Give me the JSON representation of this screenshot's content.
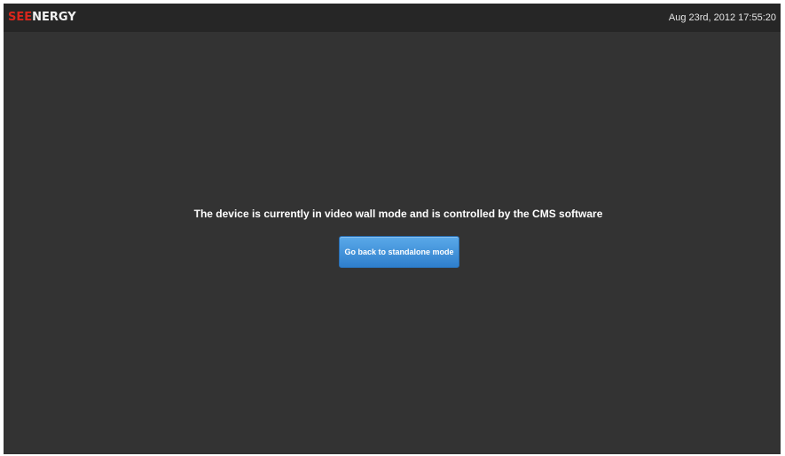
{
  "header": {
    "logo_part1": "SEE",
    "logo_part2": "NERGY",
    "datetime": "Aug 23rd, 2012 17:55:20"
  },
  "main": {
    "message": "The device is currently in video wall mode and is controlled by the CMS software",
    "button_label": "Go back to standalone mode"
  },
  "colors": {
    "background": "#333333",
    "topbar": "#262626",
    "logo_red": "#d8261c",
    "button": "#3b8ddb"
  }
}
